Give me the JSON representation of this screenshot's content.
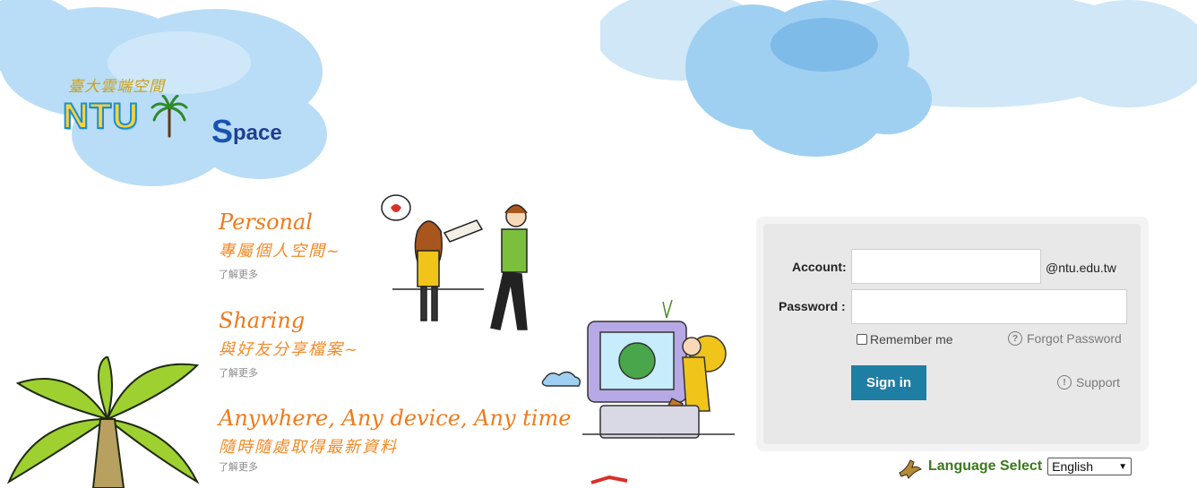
{
  "logo": {
    "chinese_text": "臺大雲端空間",
    "brand_primary": "NTU",
    "brand_secondary": "pace",
    "brand_initial": "S"
  },
  "features": [
    {
      "title": "Personal",
      "subtitle": "專屬個人空間~",
      "more": "了解更多"
    },
    {
      "title": "Sharing",
      "subtitle": "與好友分享檔案~",
      "more": "了解更多"
    },
    {
      "title": "Anywhere, Any device, Any time",
      "subtitle": "隨時隨處取得最新資料",
      "more": "了解更多"
    }
  ],
  "login": {
    "account_label": "Account:",
    "account_value": "",
    "domain_suffix": "@ntu.edu.tw",
    "password_label": "Password :",
    "password_value": "",
    "remember_label": "Remember me",
    "remember_checked": false,
    "forgot_label": "Forgot Password",
    "signin_label": "Sign in",
    "support_label": "Support"
  },
  "language": {
    "label": "Language Select",
    "selected": "English"
  },
  "colors": {
    "accent": "#1f7ea3",
    "feature_orange": "#f07a1a",
    "language_green": "#3a7a1a",
    "cloud_blue": "#9fd0f2"
  }
}
